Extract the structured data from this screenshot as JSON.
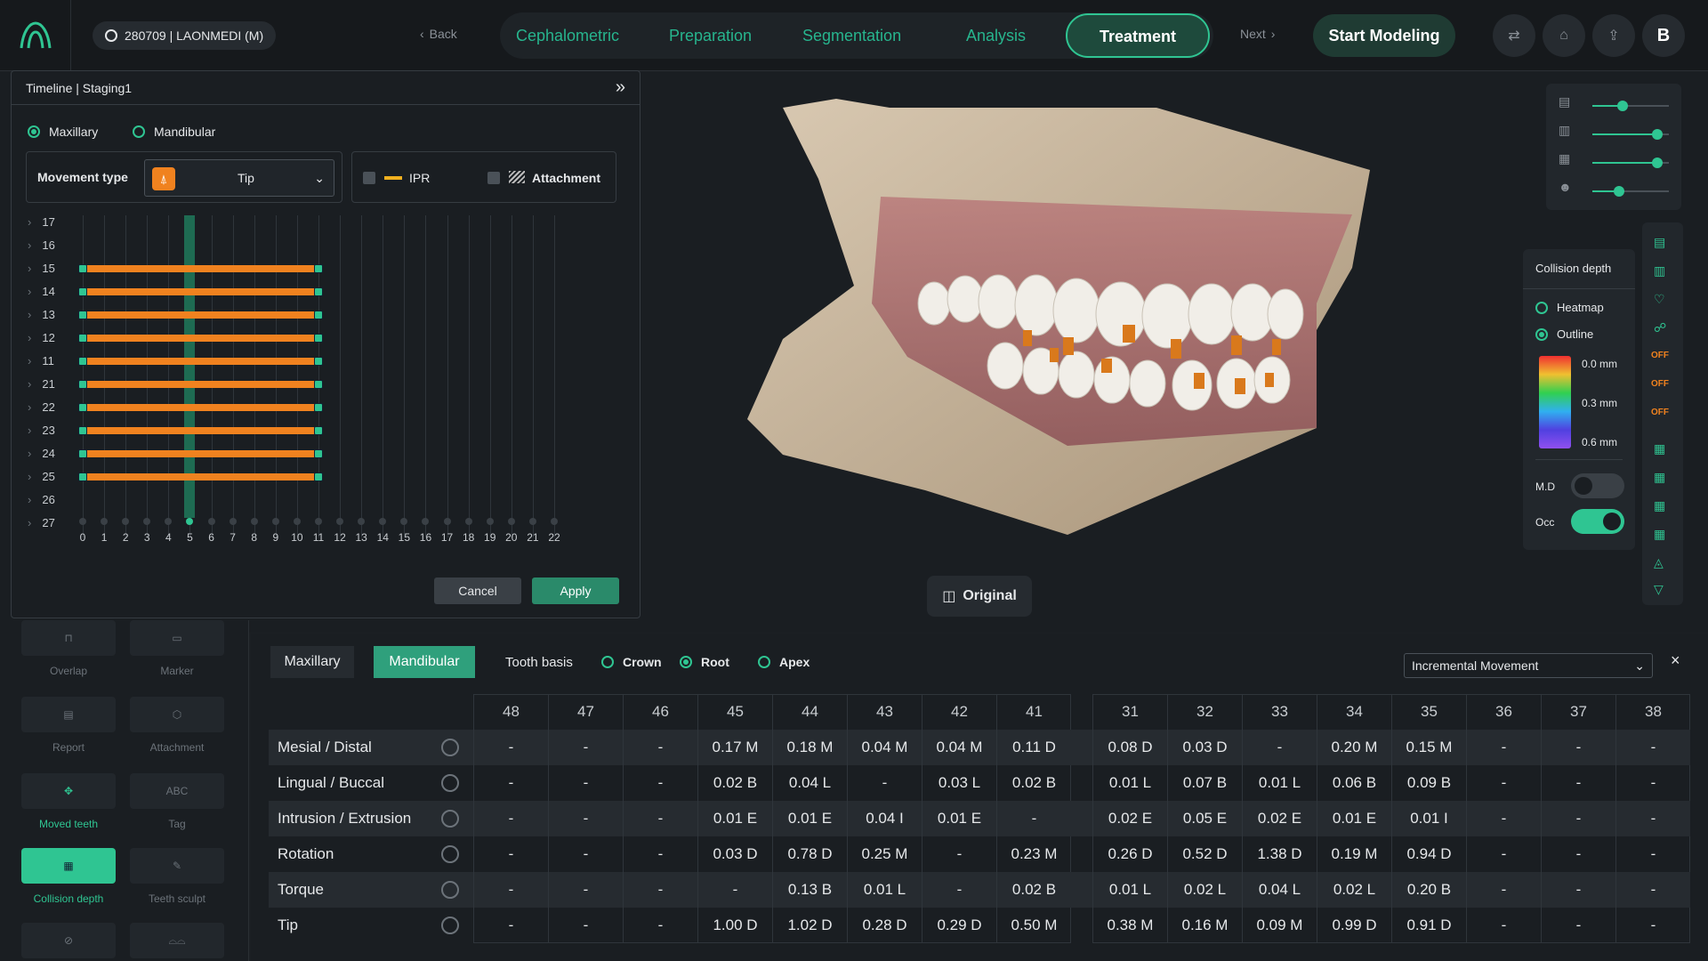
{
  "topbar": {
    "patient": "280709 | LAONMEDI (M)",
    "back": "Back",
    "next": "Next",
    "tabs": [
      "Cephalometric",
      "Preparation",
      "Segmentation",
      "Analysis",
      "Treatment"
    ],
    "active_tab": "Treatment",
    "start_modeling": "Start Modeling",
    "user_initial": "B"
  },
  "timeline": {
    "title": "Timeline | Staging1",
    "arch_options": [
      "Maxillary",
      "Mandibular"
    ],
    "selected_arch": "Maxillary",
    "movement_type_label": "Movement type",
    "movement_type_value": "Tip",
    "ipr_label": "IPR",
    "attachment_label": "Attachment",
    "teeth": [
      "17",
      "16",
      "15",
      "14",
      "13",
      "12",
      "11",
      "21",
      "22",
      "23",
      "24",
      "25",
      "26",
      "27"
    ],
    "active_teeth": [
      "15",
      "14",
      "13",
      "12",
      "11",
      "21",
      "22",
      "23",
      "24",
      "25"
    ],
    "stages": [
      "0",
      "1",
      "2",
      "3",
      "4",
      "5",
      "6",
      "7",
      "8",
      "9",
      "10",
      "11",
      "12",
      "13",
      "14",
      "15",
      "16",
      "17",
      "18",
      "19",
      "20",
      "21",
      "22"
    ],
    "current_stage": 5,
    "bar_start_stage": 0,
    "bar_end_stage": 11,
    "cancel": "Cancel",
    "apply": "Apply"
  },
  "tools": [
    {
      "label": "Overlap",
      "icon": "overlap-icon"
    },
    {
      "label": "Marker",
      "icon": "marker-icon"
    },
    {
      "label": "Report",
      "icon": "report-icon"
    },
    {
      "label": "Attachment",
      "icon": "attachment-icon"
    },
    {
      "label": "Moved teeth",
      "icon": "moved-teeth-icon"
    },
    {
      "label": "Tag",
      "icon": "tag-icon"
    },
    {
      "label": "Collision depth",
      "icon": "collision-depth-icon"
    },
    {
      "label": "Teeth sculpt",
      "icon": "teeth-sculpt-icon"
    }
  ],
  "viewport": {
    "original_label": "Original"
  },
  "collision": {
    "title": "Collision depth",
    "options": [
      "Heatmap",
      "Outline"
    ],
    "selected": "Outline",
    "scale": [
      "0.0 mm",
      "0.3 mm",
      "0.6 mm"
    ],
    "md_label": "M.D",
    "md_on": false,
    "occ_label": "Occ",
    "occ_on": true,
    "off_labels": [
      "OFF",
      "OFF",
      "OFF"
    ]
  },
  "visibility_sliders": [
    0.4,
    0.85,
    0.85,
    0.35
  ],
  "movement_table": {
    "arch_tabs": [
      "Maxillary",
      "Mandibular"
    ],
    "selected_arch": "Mandibular",
    "tooth_basis_label": "Tooth basis",
    "basis_options": [
      "Crown",
      "Root",
      "Apex"
    ],
    "selected_basis": "Root",
    "mode": "Incremental Movement",
    "left_teeth": [
      "48",
      "47",
      "46",
      "45",
      "44",
      "43",
      "42",
      "41"
    ],
    "right_teeth": [
      "31",
      "32",
      "33",
      "34",
      "35",
      "36",
      "37",
      "38"
    ],
    "rows": [
      {
        "label": "Mesial / Distal",
        "icon": "mesial-distal-icon",
        "left": [
          "-",
          "-",
          "-",
          "0.17 M",
          "0.18 M",
          "0.04 M",
          "0.04 M",
          "0.11 D"
        ],
        "right": [
          "0.08 D",
          "0.03 D",
          "-",
          "0.20 M",
          "0.15 M",
          "-",
          "-",
          "-"
        ]
      },
      {
        "label": "Lingual / Buccal",
        "icon": "lingual-buccal-icon",
        "left": [
          "-",
          "-",
          "-",
          "0.02 B",
          "0.04 L",
          "-",
          "0.03 L",
          "0.02 B"
        ],
        "right": [
          "0.01 L",
          "0.07 B",
          "0.01 L",
          "0.06 B",
          "0.09 B",
          "-",
          "-",
          "-"
        ]
      },
      {
        "label": "Intrusion / Extrusion",
        "icon": "intrusion-extrusion-icon",
        "left": [
          "-",
          "-",
          "-",
          "0.01 E",
          "0.01 E",
          "0.04 I",
          "0.01 E",
          "-"
        ],
        "right": [
          "0.02 E",
          "0.05 E",
          "0.02 E",
          "0.01 E",
          "0.01 I",
          "-",
          "-",
          "-"
        ]
      },
      {
        "label": "Rotation",
        "icon": "rotation-icon",
        "left": [
          "-",
          "-",
          "-",
          "0.03 D",
          "0.78 D",
          "0.25 M",
          "-",
          "0.23 M"
        ],
        "right": [
          "0.26 D",
          "0.52 D",
          "1.38 D",
          "0.19 M",
          "0.94 D",
          "-",
          "-",
          "-"
        ]
      },
      {
        "label": "Torque",
        "icon": "torque-icon",
        "left": [
          "-",
          "-",
          "-",
          "-",
          "0.13 B",
          "0.01 L",
          "-",
          "0.02 B"
        ],
        "right": [
          "0.01 L",
          "0.02 L",
          "0.04 L",
          "0.02 L",
          "0.20 B",
          "-",
          "-",
          "-"
        ]
      },
      {
        "label": "Tip",
        "icon": "tip-icon",
        "left": [
          "-",
          "-",
          "-",
          "1.00 D",
          "1.02 D",
          "0.28 D",
          "0.29 D",
          "0.50 M"
        ],
        "right": [
          "0.38 M",
          "0.16 M",
          "0.09 M",
          "0.99 D",
          "0.91 D",
          "-",
          "-",
          "-"
        ]
      }
    ]
  },
  "colors": {
    "accent": "#2fc592",
    "bar": "#f0821f",
    "bg": "#1a1e22"
  }
}
